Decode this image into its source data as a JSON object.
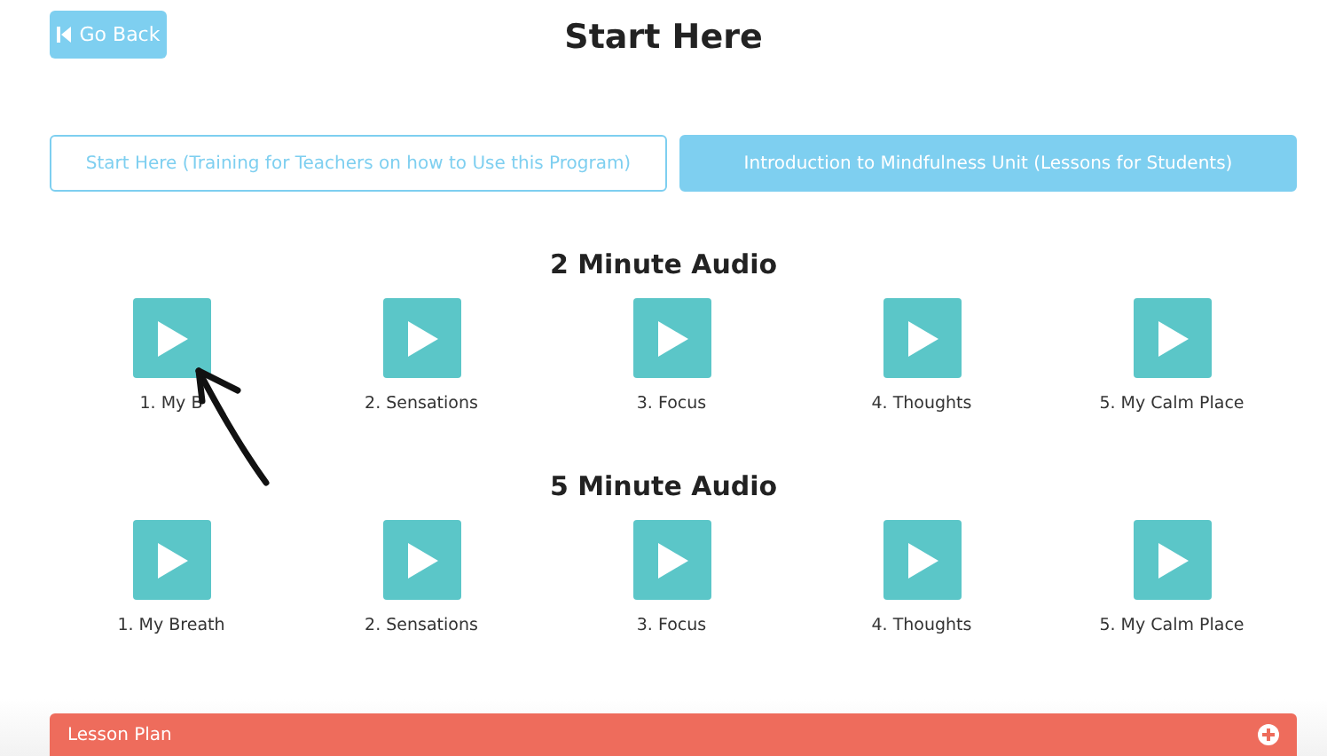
{
  "back_button": {
    "label": "Go Back"
  },
  "title": "Start Here",
  "tabs": [
    {
      "label": "Start Here (Training for Teachers on how to Use this Program)",
      "selected": false
    },
    {
      "label": "Introduction to Mindfulness Unit (Lessons for Students)",
      "selected": true
    }
  ],
  "sections": [
    {
      "heading": "2 Minute Audio",
      "tracks": [
        {
          "label": "1. My B"
        },
        {
          "label": "2. Sensations"
        },
        {
          "label": "3. Focus"
        },
        {
          "label": "4. Thoughts"
        },
        {
          "label": "5. My Calm Place"
        }
      ]
    },
    {
      "heading": "5 Minute Audio",
      "tracks": [
        {
          "label": "1. My Breath"
        },
        {
          "label": "2. Sensations"
        },
        {
          "label": "3. Focus"
        },
        {
          "label": "4. Thoughts"
        },
        {
          "label": "5. My Calm Place"
        }
      ]
    }
  ],
  "accordion": {
    "label": "Lesson Plan",
    "expanded": false
  }
}
